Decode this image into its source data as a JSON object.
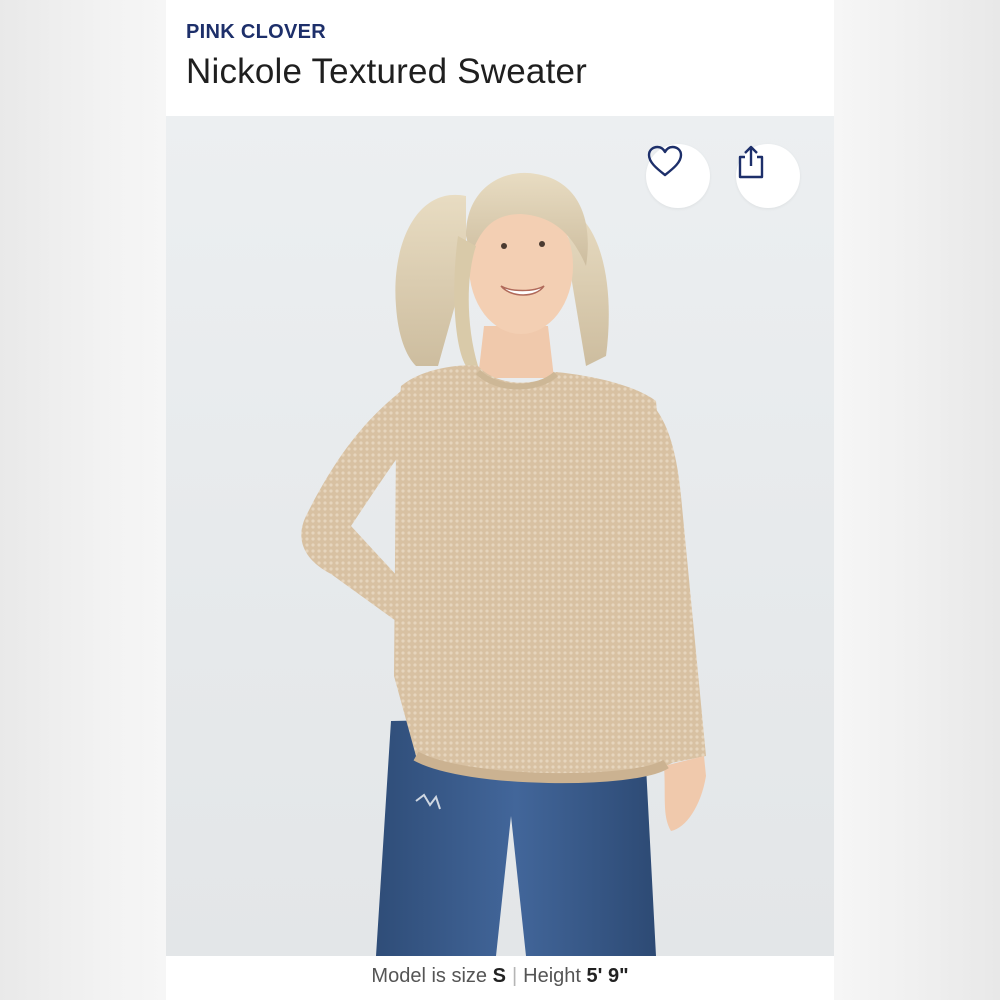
{
  "product": {
    "brand": "PINK CLOVER",
    "title": "Nickole Textured Sweater"
  },
  "actions": {
    "favorite_icon": "heart-icon",
    "share_icon": "share-icon"
  },
  "model_info": {
    "size_label": "Model is size",
    "size_value": "S",
    "separator": "|",
    "height_label": "Height",
    "height_value": "5' 9\""
  },
  "colors": {
    "brand": "#1d2f6a",
    "title": "#1f1f1f",
    "sweater": "#d9c3a5",
    "jeans": "#3a5a86"
  }
}
